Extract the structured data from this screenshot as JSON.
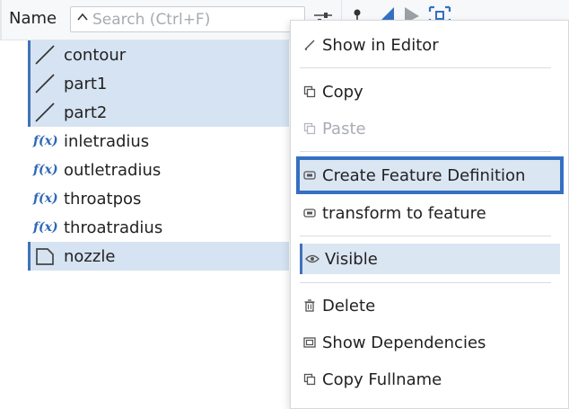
{
  "header": {
    "column_title": "Name",
    "search_placeholder": "Search (Ctrl+F)"
  },
  "tree": {
    "items": [
      {
        "label": "contour",
        "icon": "line-icon",
        "selected": true
      },
      {
        "label": "part1",
        "icon": "line-icon",
        "selected": true
      },
      {
        "label": "part2",
        "icon": "line-icon",
        "selected": true
      },
      {
        "label": "inletradius",
        "icon": "function-icon",
        "prefix": "f(x)",
        "selected": false
      },
      {
        "label": "outletradius",
        "icon": "function-icon",
        "prefix": "f(x)",
        "selected": false
      },
      {
        "label": "throatpos",
        "icon": "function-icon",
        "prefix": "f(x)",
        "selected": false
      },
      {
        "label": "throatradius",
        "icon": "function-icon",
        "prefix": "f(x)",
        "selected": false
      },
      {
        "label": "nozzle",
        "icon": "face-icon",
        "selected": true
      }
    ]
  },
  "menu": {
    "show_in_editor": "Show in Editor",
    "copy": "Copy",
    "paste": "Paste",
    "create_feature_definition": "Create Feature Definition",
    "transform_to_feature": "transform to feature",
    "visible": "Visible",
    "delete": "Delete",
    "show_dependencies": "Show Dependencies",
    "copy_fullname": "Copy Fullname"
  },
  "colors": {
    "selection": "#d6e3f2",
    "accent": "#3570c1",
    "fx": "#2e67b7"
  }
}
